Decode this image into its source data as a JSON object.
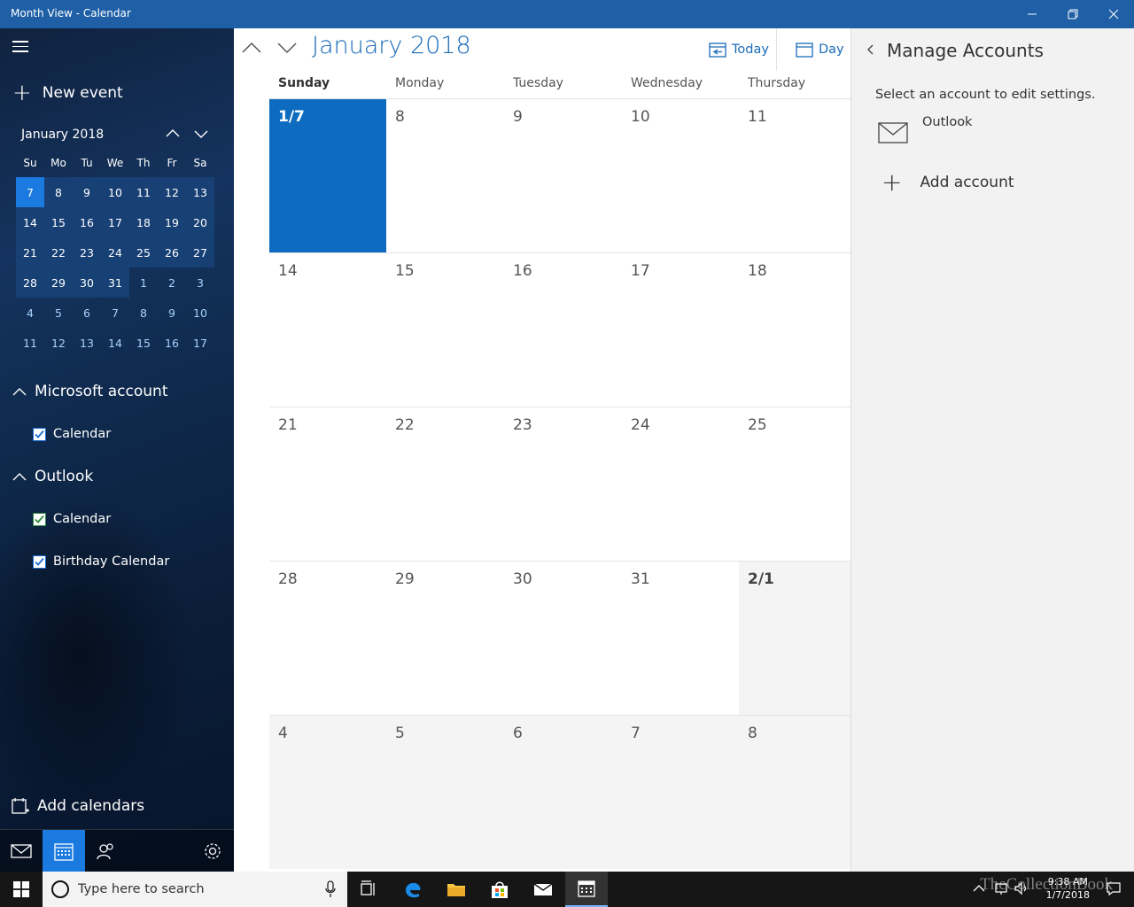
{
  "window": {
    "title": "Month View - Calendar"
  },
  "sidebar": {
    "new_event": "New event",
    "mini_calendar": {
      "title": "January 2018",
      "weekdays": [
        "Su",
        "Mo",
        "Tu",
        "We",
        "Th",
        "Fr",
        "Sa"
      ],
      "weeks": [
        [
          "7",
          "8",
          "9",
          "10",
          "11",
          "12",
          "13"
        ],
        [
          "14",
          "15",
          "16",
          "17",
          "18",
          "19",
          "20"
        ],
        [
          "21",
          "22",
          "23",
          "24",
          "25",
          "26",
          "27"
        ],
        [
          "28",
          "29",
          "30",
          "31",
          "1",
          "2",
          "3"
        ],
        [
          "4",
          "5",
          "6",
          "7",
          "8",
          "9",
          "10"
        ],
        [
          "11",
          "12",
          "13",
          "14",
          "15",
          "16",
          "17"
        ]
      ]
    },
    "groups": [
      {
        "name": "Microsoft account",
        "calendars": [
          {
            "label": "Calendar",
            "color": "#1a6bd6"
          }
        ]
      },
      {
        "name": "Outlook",
        "calendars": [
          {
            "label": "Calendar",
            "color": "#2e8b3e"
          },
          {
            "label": "Birthday Calendar",
            "color": "#1a6bd6"
          }
        ]
      }
    ],
    "add_calendars": "Add calendars"
  },
  "main": {
    "title": "January 2018",
    "today_label": "Today",
    "view_label": "Day",
    "day_headers": [
      "Sunday",
      "Monday",
      "Tuesday",
      "Wednesday",
      "Thursday"
    ],
    "weeks": [
      [
        "1/7",
        "8",
        "9",
        "10",
        "11"
      ],
      [
        "14",
        "15",
        "16",
        "17",
        "18"
      ],
      [
        "21",
        "22",
        "23",
        "24",
        "25"
      ],
      [
        "28",
        "29",
        "30",
        "31",
        "2/1"
      ],
      [
        "4",
        "5",
        "6",
        "7",
        "8"
      ]
    ]
  },
  "panel": {
    "title": "Manage Accounts",
    "description": "Select an account to edit settings.",
    "account": "Outlook",
    "add_account": "Add account"
  },
  "taskbar": {
    "search_placeholder": "Type here to search",
    "time": "9:38 AM",
    "date": "1/7/2018",
    "watermark": "TheCollectionBook"
  },
  "colors": {
    "accent": "#1a6bb8",
    "selected_day": "#0d6cc0",
    "titlebar": "#1e5fa6"
  }
}
